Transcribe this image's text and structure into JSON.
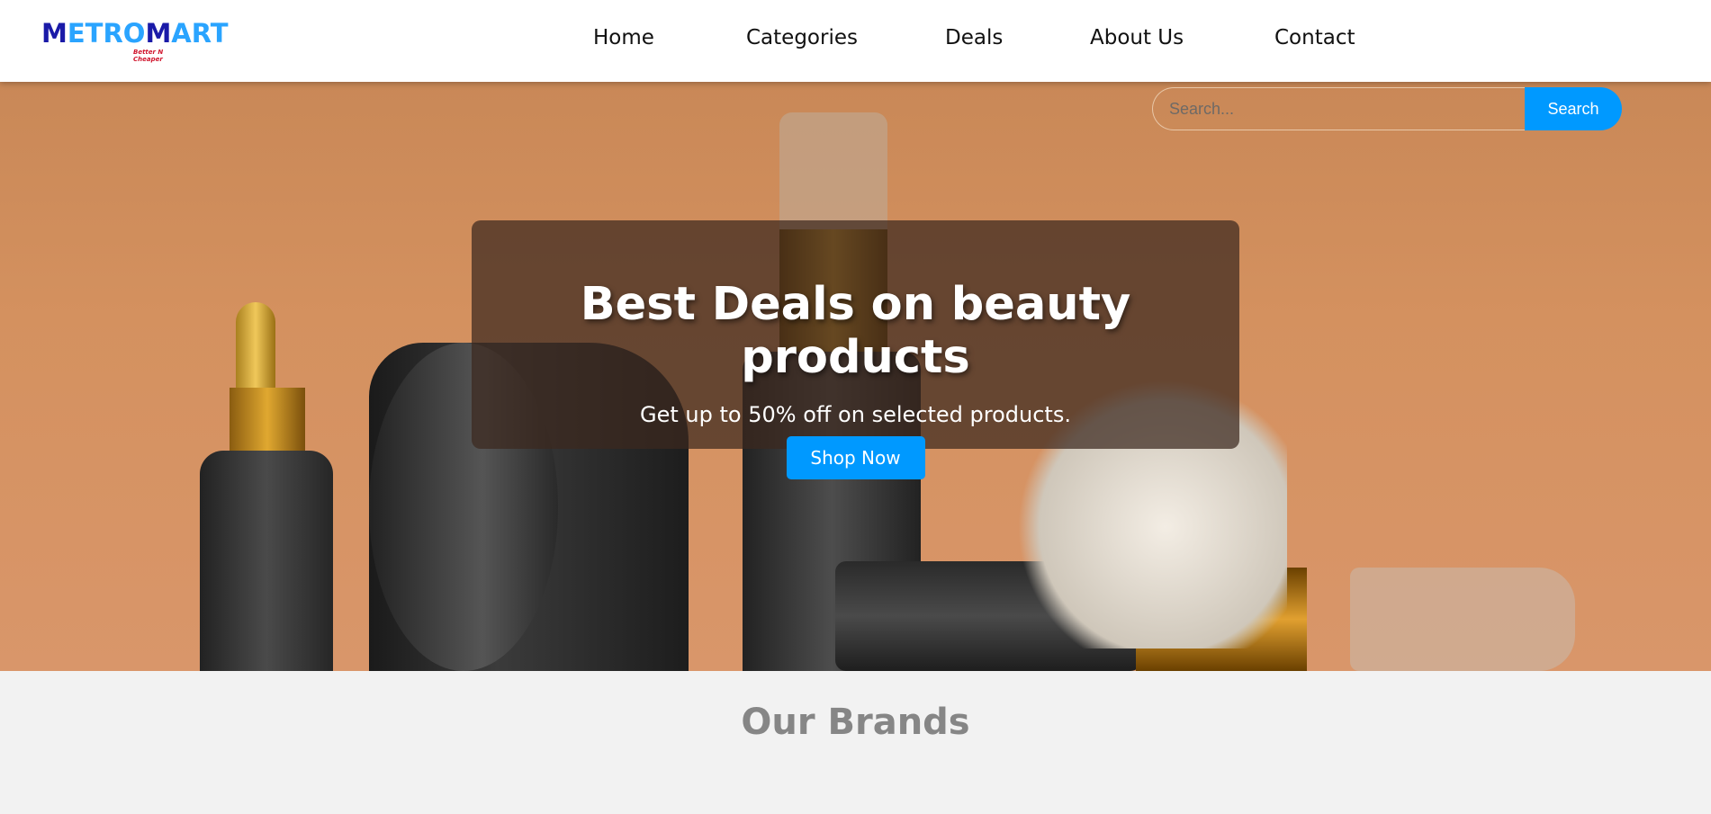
{
  "header": {
    "logo_text": "METROMART",
    "logo_tagline": "Better N Cheaper",
    "nav": [
      "Home",
      "Categories",
      "Deals",
      "About Us",
      "Contact"
    ]
  },
  "search": {
    "placeholder": "Search...",
    "button": "Search"
  },
  "hero": {
    "title": "Best Deals on beauty products",
    "subtitle": "Get up to 50% off on selected products.",
    "cta": "Shop Now"
  },
  "brands": {
    "title": "Our Brands"
  },
  "colors": {
    "accent": "#0099ff",
    "hero_bg": "#d4915f",
    "logo_dark": "#1a1aa8",
    "logo_light": "#2aa4ff"
  }
}
